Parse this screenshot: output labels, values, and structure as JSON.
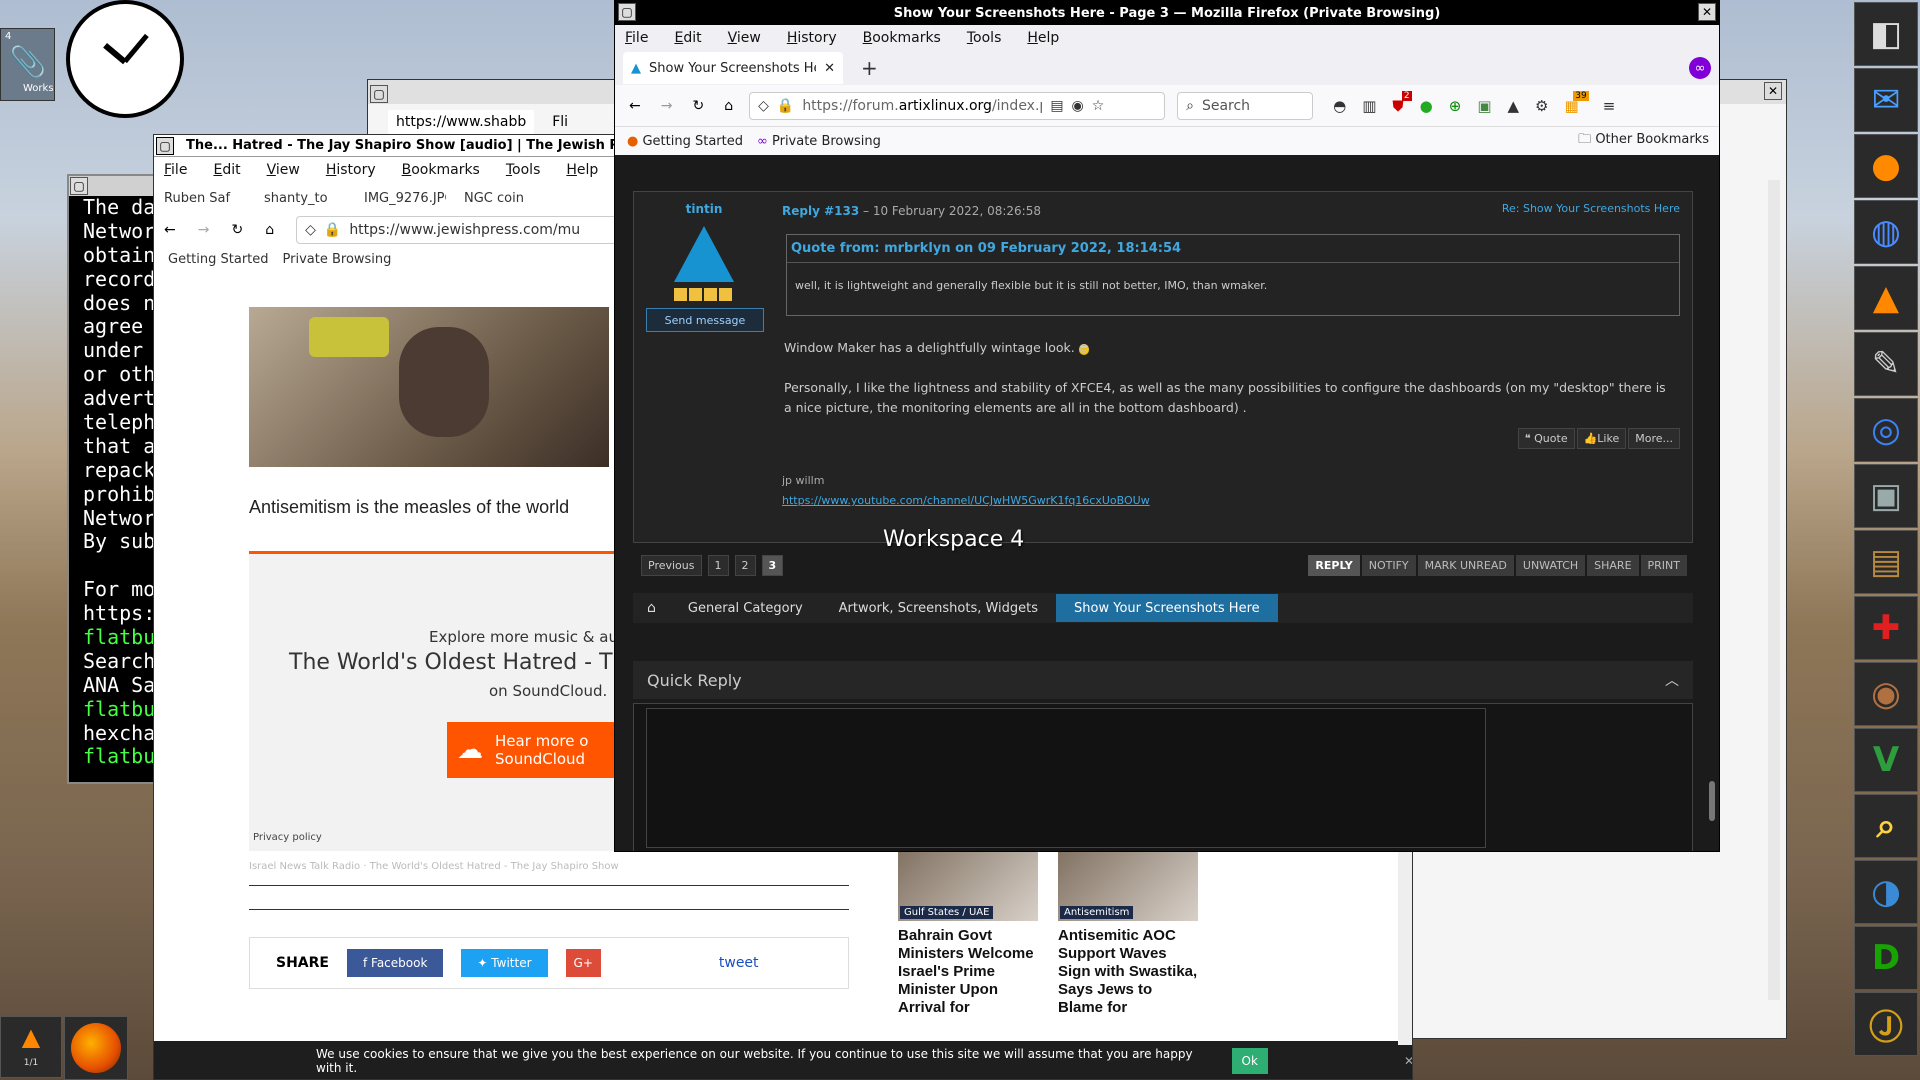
{
  "desktop": {
    "workspace_label": "Workspace 4",
    "wmaker_workspace_number": "4",
    "wmaker_workspace_name": "Works",
    "wmaker_pager": "1/1"
  },
  "back_window": {
    "tab1": "https://www.shabb",
    "tab2": "Fli"
  },
  "terminal": {
    "lines": [
      {
        "text": "The da",
        "color": "#ffffff"
      },
      {
        "text": "Networ",
        "color": "#ffffff"
      },
      {
        "text": "obtain",
        "color": "#ffffff"
      },
      {
        "text": "record",
        "color": "#ffffff"
      },
      {
        "text": "does n",
        "color": "#ffffff"
      },
      {
        "text": "agree",
        "color": "#ffffff"
      },
      {
        "text": "under",
        "color": "#ffffff"
      },
      {
        "text": "or oth",
        "color": "#ffffff"
      },
      {
        "text": "advert",
        "color": "#ffffff"
      },
      {
        "text": "teleph",
        "color": "#ffffff"
      },
      {
        "text": "that a",
        "color": "#ffffff"
      },
      {
        "text": "repack",
        "color": "#ffffff"
      },
      {
        "text": "prohib",
        "color": "#ffffff"
      },
      {
        "text": "Networ",
        "color": "#ffffff"
      },
      {
        "text": "By sub",
        "color": "#ffffff"
      },
      {
        "text": "",
        "color": "#ffffff"
      },
      {
        "text": "For mo",
        "color": "#ffffff"
      },
      {
        "text": "https:",
        "color": "#ffffff"
      },
      {
        "text": "flatbu",
        "color": "#44ff44"
      },
      {
        "text": "Search",
        "color": "#ffffff"
      },
      {
        "text": "ANA Sa",
        "color": "#ffffff"
      },
      {
        "text": "flatbu",
        "color": "#44ff44"
      },
      {
        "text": "hexcha",
        "color": "#ffffff"
      },
      {
        "text": "flatbu",
        "color": "#44ff44"
      }
    ]
  },
  "jewishpress": {
    "title": "The... Hatred - The Jay Shapiro Show [audio] | The Jewish Press",
    "menu": [
      "File",
      "Edit",
      "View",
      "History",
      "Bookmarks",
      "Tools",
      "Help"
    ],
    "tabs": [
      "Ruben Saf",
      "shanty_to",
      "IMG_9276.JPG",
      "NGC coin"
    ],
    "url": "https://www.jewishpress.com/mu",
    "bookmarks": [
      "Getting Started",
      "Private Browsing"
    ],
    "caption": "Antisemitism is the measles of the world",
    "soundcloud": {
      "explore": "Explore more music & au",
      "title": "The World's Oldest Hatred - Th",
      "on": "on SoundCloud.",
      "hear": "Hear more o",
      "sc": "SoundCloud",
      "privacy": "Privacy policy"
    },
    "credit": "Israel News Talk Radio · The World's Oldest Hatred - The Jay Shapiro Show",
    "share": {
      "label": "SHARE",
      "facebook": "Facebook",
      "twitter": "Twitter",
      "gplus": "G+",
      "tweet": "tweet"
    },
    "news": [
      {
        "tag": "Gulf States / UAE",
        "headline": "Bahrain Govt Ministers Welcome Israel's Prime Minister Upon Arrival for"
      },
      {
        "tag": "Antisemitism",
        "headline": "Antisemitic AOC Support Waves Sign with Swastika, Says Jews to Blame for"
      }
    ],
    "cookie": {
      "text": "We use cookies to ensure that we give you the best experience on our website. If you continue to use this site we will assume that you are happy with it.",
      "ok": "Ok"
    }
  },
  "main": {
    "title": "Show Your Screenshots Here - Page 3 — Mozilla Firefox (Private Browsing)",
    "menu": [
      "File",
      "Edit",
      "View",
      "History",
      "Bookmarks",
      "Tools",
      "Help"
    ],
    "tab": "Show Your Screenshots He",
    "url_prefix": "https://forum.",
    "url_domain": "artixlinux.org",
    "url_suffix": "/index.php",
    "search_placeholder": "Search",
    "bookmarks": [
      "Getting Started",
      "Private Browsing"
    ],
    "other_bookmarks": "Other Bookmarks",
    "badges": {
      "b1": "2",
      "b2": "39"
    },
    "post": {
      "author": "tintin",
      "send": "Send message",
      "reply_num": "Reply #133",
      "date": "– 10 February 2022, 08:26:58",
      "re": "Re: Show Your Screenshots Here",
      "quote_from": "Quote from: mrbrklyn on 09 February 2022, 18:14:54",
      "quote_text": "well, it is lightweight and generally flexible but it is still not better, IMO, than wmaker.",
      "p1": "Window Maker has a delightfully wintage look.",
      "p2": "Personally, I like the lightness and stability of XFCE4, as well as the many possibilities to configure the dashboards (on my \"desktop\" there is a nice picture, the monitoring elements are all in the bottom dashboard) .",
      "actions": [
        "Quote",
        "Like",
        "More..."
      ],
      "sig": "jp willm",
      "sig_link": "https://www.youtube.com/channel/UCJwHW5GwrK1fq16cxUoBOUw"
    },
    "pages": {
      "prev": "Previous",
      "nums": [
        "1",
        "2",
        "3"
      ],
      "active": "3"
    },
    "topic_actions": [
      "REPLY",
      "NOTIFY",
      "MARK UNREAD",
      "UNWATCH",
      "SHARE",
      "PRINT"
    ],
    "breadcrumbs": [
      "General Category",
      "Artwork, Screenshots, Widgets",
      "Show Your Screenshots Here"
    ],
    "quick_reply": "Quick Reply"
  },
  "dock": [
    "terminal-app",
    "thunderbird",
    "firefox",
    "globe",
    "vlc",
    "gimp",
    "chromium",
    "cube",
    "box",
    "xchat",
    "speaker",
    "vim",
    "magnifier",
    "bluefish",
    "libreoffice-d",
    "jr"
  ]
}
